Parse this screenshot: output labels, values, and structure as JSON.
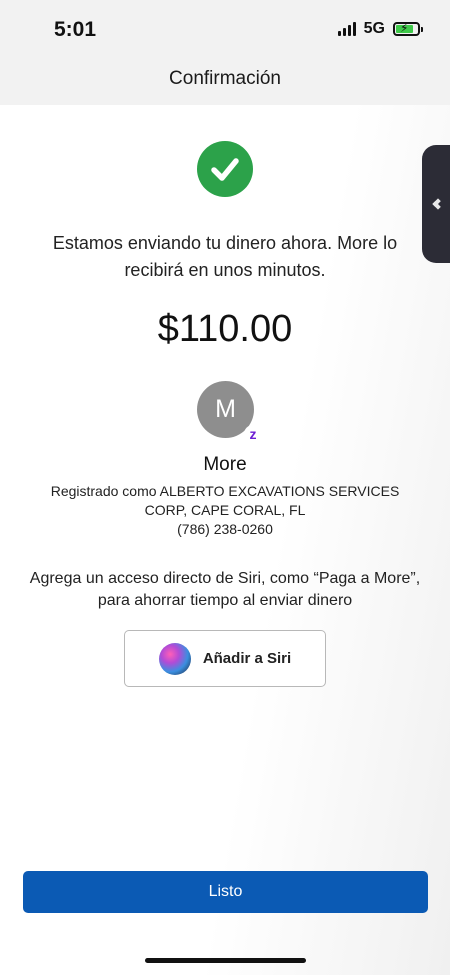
{
  "status_bar": {
    "time": "5:01",
    "network": "5G"
  },
  "header": {
    "title": "Confirmación"
  },
  "confirmation": {
    "message": "Estamos enviando tu dinero ahora. More lo recibirá en unos minutos.",
    "amount": "$110.00"
  },
  "recipient": {
    "initial": "M",
    "badge": "z",
    "name": "More",
    "registered_line1": "Registrado como ALBERTO EXCAVATIONS SERVICES",
    "registered_line2": "CORP, CAPE CORAL, FL",
    "phone": "(786) 238-0260"
  },
  "siri": {
    "prompt_line1": "Agrega un acceso directo de Siri, como “Paga a More”,",
    "prompt_line2": "para ahorrar tiempo al enviar dinero",
    "button_label": "Añadir a Siri"
  },
  "actions": {
    "done_label": "Listo"
  },
  "colors": {
    "success_green": "#2ca24a",
    "primary_blue": "#0b5ab4",
    "zelle_purple": "#6d1ed4",
    "avatar_gray": "#8e8e8e"
  },
  "icons": {
    "check": "checkmark-icon",
    "side_tab": "chevron-left-icon",
    "siri": "siri-icon"
  }
}
